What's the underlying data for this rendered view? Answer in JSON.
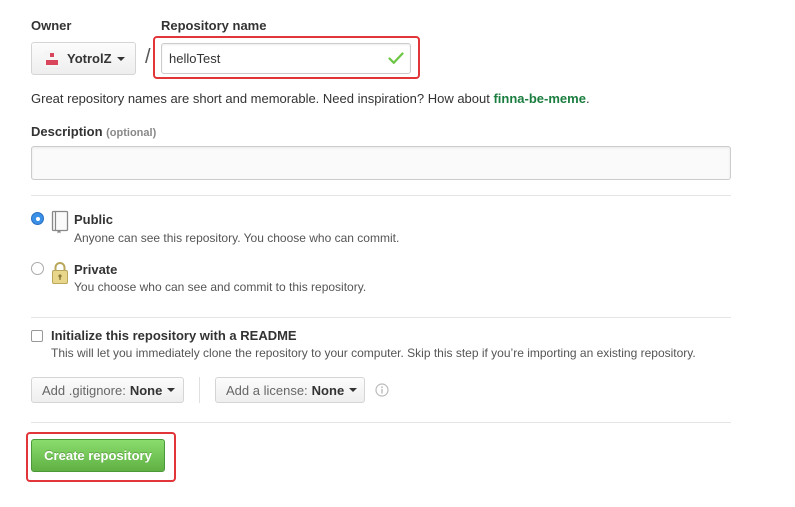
{
  "owner": {
    "label": "Owner",
    "selected": "YotrolZ"
  },
  "separator": "/",
  "repository": {
    "label": "Repository name",
    "value": "helloTest",
    "valid_icon": "check-icon"
  },
  "hint": {
    "text": "Great repository names are short and memorable. Need inspiration? How about ",
    "suggestion": "finna-be-meme",
    "suffix": "."
  },
  "description": {
    "label": "Description",
    "optional": "(optional)",
    "value": ""
  },
  "visibility": {
    "selected": "public",
    "public": {
      "title": "Public",
      "desc": "Anyone can see this repository. You choose who can commit.",
      "icon": "book-icon"
    },
    "private": {
      "title": "Private",
      "desc": "You choose who can see and commit to this repository.",
      "icon": "lock-icon"
    }
  },
  "init": {
    "checked": false,
    "title": "Initialize this repository with a README",
    "desc": "This will let you immediately clone the repository to your computer. Skip this step if you’re importing an existing repository."
  },
  "gitignore": {
    "label": "Add .gitignore:",
    "value": "None"
  },
  "license": {
    "label": "Add a license:",
    "value": "None",
    "info_icon": "info-icon"
  },
  "submit": {
    "label": "Create repository"
  },
  "colors": {
    "highlight_border": "#e2353a",
    "primary_button": "#60b044",
    "suggestion_link": "#1b7d3f",
    "valid_check": "#6cc644",
    "radio_selected": "#3a8fe6"
  }
}
